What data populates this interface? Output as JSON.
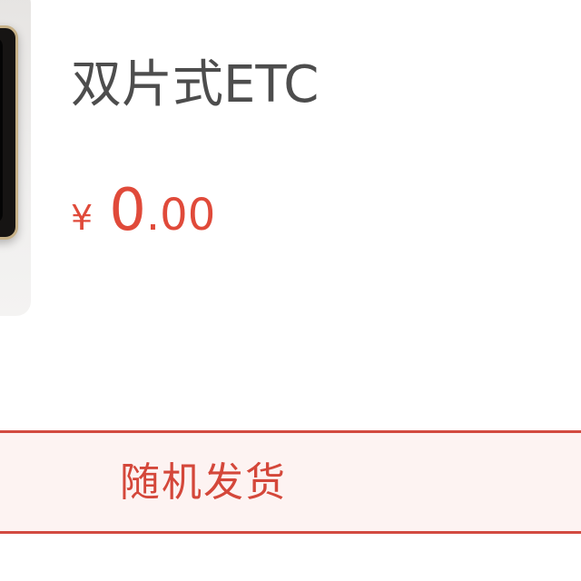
{
  "product": {
    "title": "双片式ETC",
    "price": {
      "currency": "¥",
      "integer": "0",
      "decimal": ".00"
    },
    "thumbnail_icon": "etc-device-image"
  },
  "option": {
    "label": "随机发货",
    "selected": true
  },
  "colors": {
    "accent": "#e04a3a",
    "option_border": "#d24a40",
    "option_background": "#fdf3f2",
    "title_text": "#4d4d4d"
  }
}
